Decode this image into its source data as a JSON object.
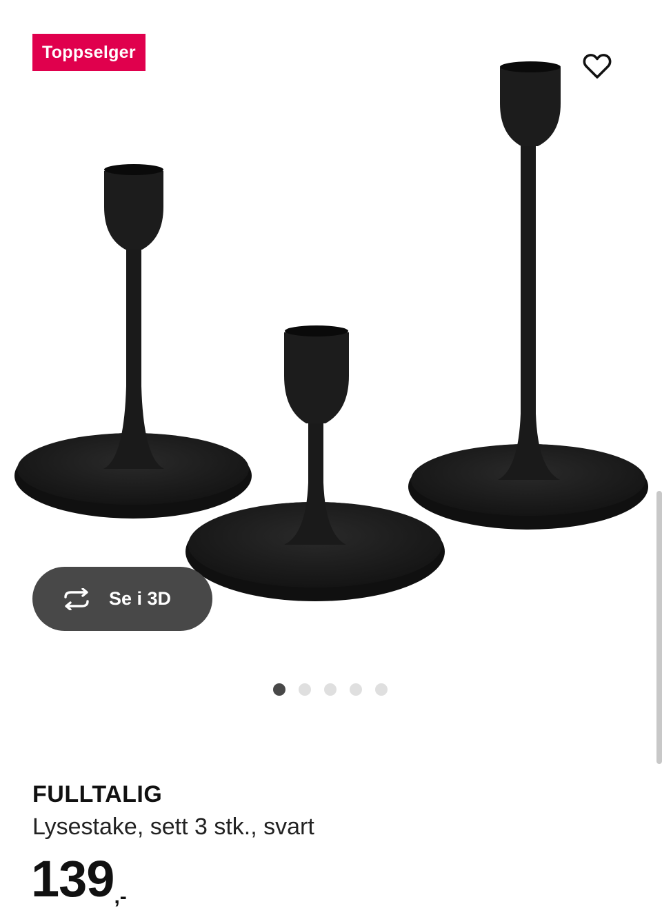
{
  "badge": {
    "label": "Toppselger",
    "color": "#e0004d"
  },
  "favorite": {
    "icon": "heart-outline-icon"
  },
  "view_3d": {
    "label": "Se i 3D",
    "icon": "rotate-3d-icon"
  },
  "carousel": {
    "total_images": 5,
    "active_index": 0
  },
  "product": {
    "name": "FULLTALIG",
    "description": "Lysestake, sett 3 stk., svart",
    "price_amount": "139",
    "price_suffix": ",-"
  },
  "colors": {
    "accent_dark": "#484848",
    "badge": "#e0004d",
    "product": "#1c1c1c"
  }
}
